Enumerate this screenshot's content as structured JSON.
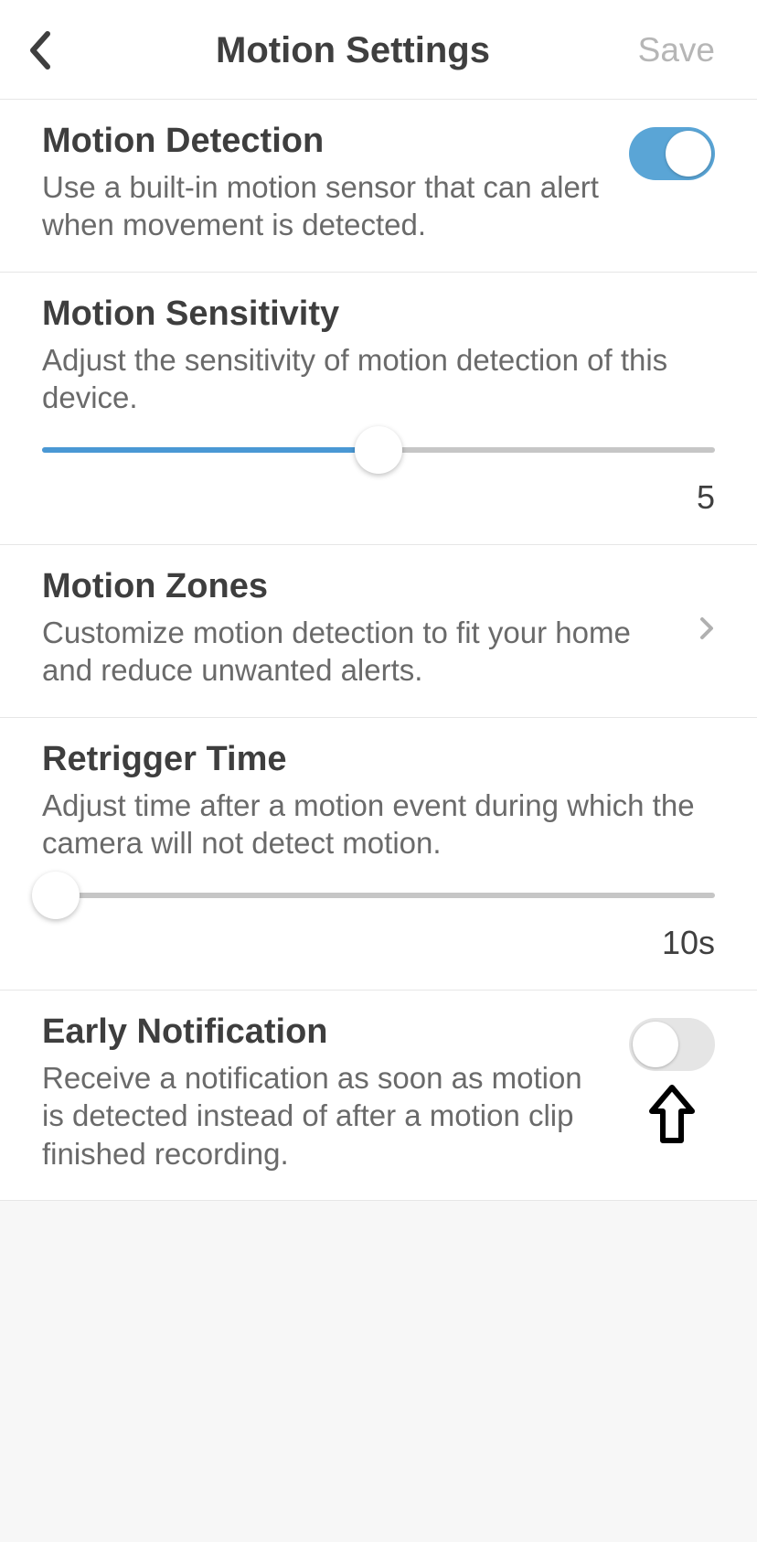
{
  "header": {
    "title": "Motion Settings",
    "save_label": "Save"
  },
  "motion_detection": {
    "title": "Motion Detection",
    "desc": "Use a built-in motion sensor that can alert when movement is detected.",
    "enabled": true
  },
  "motion_sensitivity": {
    "title": "Motion Sensitivity",
    "desc": "Adjust the sensitivity of motion detection of this device.",
    "value_display": "5",
    "percent": 50
  },
  "motion_zones": {
    "title": "Motion Zones",
    "desc": "Customize motion detection to fit your home and reduce unwanted alerts."
  },
  "retrigger_time": {
    "title": "Retrigger Time",
    "desc": "Adjust time after a motion event during which the camera will not detect motion.",
    "value_display": "10s",
    "percent": 2
  },
  "early_notification": {
    "title": "Early Notification",
    "desc": "Receive a notification as soon as motion is detected instead of after a motion clip finished recording.",
    "enabled": false
  }
}
